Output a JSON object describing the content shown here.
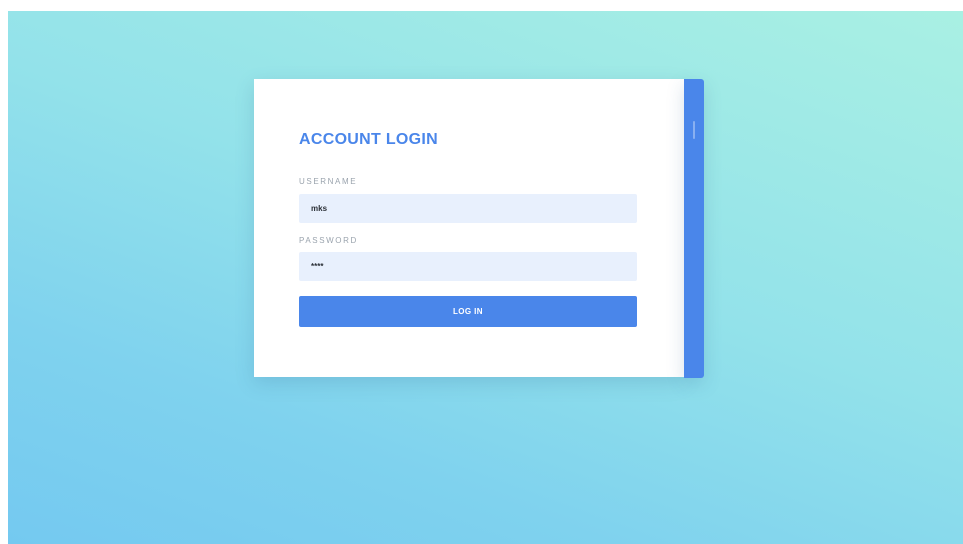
{
  "login": {
    "title": "ACCOUNT LOGIN",
    "username_label": "USERNAME",
    "username_value": "mks",
    "password_label": "PASSWORD",
    "password_value": "****",
    "button_label": "LOG IN"
  },
  "colors": {
    "accent": "#4a86ea",
    "input_bg": "#e8f0fd",
    "background_start": "#a9f0e3",
    "background_end": "#74c9f0"
  }
}
